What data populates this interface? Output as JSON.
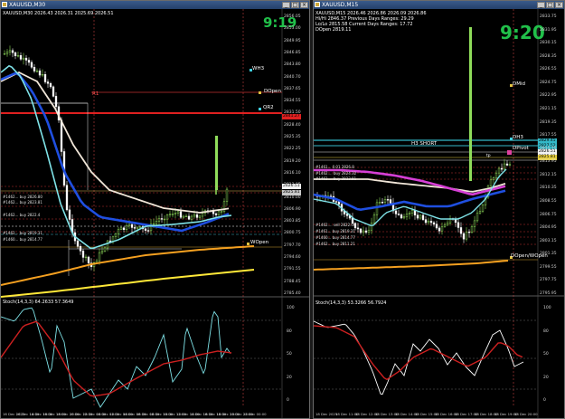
{
  "left": {
    "title": "XAUUSD,M30",
    "header": "XAUUSD,M30  2026.43 2026.31 2025.69 2026.51",
    "clock": "9:19",
    "labels": {
      "wh3": "WH3",
      "dopen": "DOpen",
      "qr2": "QR2",
      "wopen": "WOpen",
      "r1": "R1"
    },
    "price_axis": [
      "2856.05",
      "2853.00",
      "2849.95",
      "2846.85",
      "2843.80",
      "2840.70",
      "2837.65",
      "2834.55",
      "2831.50",
      "2828.40",
      "2825.35",
      "2822.25",
      "2819.20",
      "2816.10",
      "2813.05",
      "2810.00",
      "2806.90",
      "2803.85",
      "2800.75",
      "2797.70",
      "2794.60",
      "2791.55",
      "2788.45",
      "2785.40"
    ],
    "price_tags": [
      {
        "text": "2841.27",
        "color": "#e02020"
      },
      {
        "text": "2826.51",
        "color": "#f2f2f2"
      },
      {
        "text": "2825.81",
        "color": "#c8c8c8"
      }
    ],
    "trade_labels": [
      "#1462... buy 2826.80",
      "#1462... buy 2823.81",
      "#1462... buy 2822.4",
      "#1462... buy 2819.31",
      "#1460... buy 2814.77"
    ],
    "ind_header": "Stoch(14,3,3) 64.2633 57.3649",
    "ind_axis": [
      "100",
      "80",
      "50",
      "20",
      "0"
    ],
    "time_axis": [
      "16 Dec 2025",
      "16 Dec 14:00",
      "16 Dec 16:00",
      "16 Dec 18:00",
      "16 Dec 20:00",
      "16 Dec 22:00",
      "18 Dec 00:00",
      "18 Dec 02:00",
      "18 Dec 04:00",
      "18 Dec 06:00",
      "18 Dec 08:00",
      "18 Dec 10:00",
      "18 Dec 12:00",
      "18 Dec 14:00",
      "18 Dec 16:00",
      "18 Dec 18:00",
      "18 Dec 20:00",
      "18 Dec 22:00",
      "18 Dec 00:00"
    ]
  },
  "right": {
    "title": "XAUUSD,M15",
    "header_lines": [
      "XAUUSD,M15  2026.46 2026.86 2026.09 2026.86",
      "Hi/Hi 2846.37   Previous Days Ranges: 29.29",
      "Lo/Lo 2815.58   Current Days Ranges: 17.72",
      "DOpen 2819.11"
    ],
    "clock": "9:20",
    "h3_short": "H3 SHORT",
    "labels": {
      "dmid": "DMid",
      "dh3": "DH3",
      "dpivot": "DPivot",
      "dopen_wopen": "DOpen/WOpen",
      "tp": "tp"
    },
    "price_axis": [
      "2833.75",
      "2831.95",
      "2830.15",
      "2828.35",
      "2826.55",
      "2824.75",
      "2822.95",
      "2821.15",
      "2819.35",
      "2817.55",
      "2815.75",
      "2813.95",
      "2812.15",
      "2810.35",
      "2808.55",
      "2806.75",
      "2804.95",
      "2803.15",
      "2801.35",
      "2799.55",
      "2797.75",
      "2795.95"
    ],
    "price_tags": [
      {
        "text": "2829.45",
        "color": "#33b8c8"
      },
      {
        "text": "2827.52",
        "color": "#33b8c8"
      },
      {
        "text": "2826.51",
        "color": "#f2f2f2"
      },
      {
        "text": "2825.81",
        "color": "#e8d040"
      }
    ],
    "trade_labels": [
      "#1461... 0.01 2826.8",
      "#1462.... buy 2824.32",
      "#1462.... buy 2823.81",
      "#1462.... sell 2822.00",
      "#1461... buy 2819.31",
      "#1460... buy 2814.77",
      "#1462... buy 2811.21"
    ],
    "ind_header": "Stoch(14,3,3) 53.3266 56.7924",
    "ind_axis": [
      "100",
      "80",
      "50",
      "20",
      "0"
    ],
    "time_axis": [
      "18 Dec 2025",
      "18 Dec 11:00",
      "18 Dec 12:00",
      "18 Dec 13:00",
      "18 Dec 14:00",
      "18 Dec 15:00",
      "18 Dec 16:00",
      "18 Dec 17:00",
      "18 Dec 18:00",
      "18 Dec 19:00",
      "18 Dec 20:00"
    ]
  },
  "colors": {
    "bull": "#8fdc5a",
    "bear": "#ffffff",
    "ema_blue": "#1f4fe0",
    "ema_cyan": "#7fe3e8",
    "ema_white": "#f0e6d8",
    "ma_orange": "#f5a020",
    "ma_yellow": "#ffe838",
    "magenta": "#d63fd6",
    "level_red": "#e02020",
    "stoch_main": "#7fe3e8",
    "stoch_signal": "#cc2020"
  }
}
